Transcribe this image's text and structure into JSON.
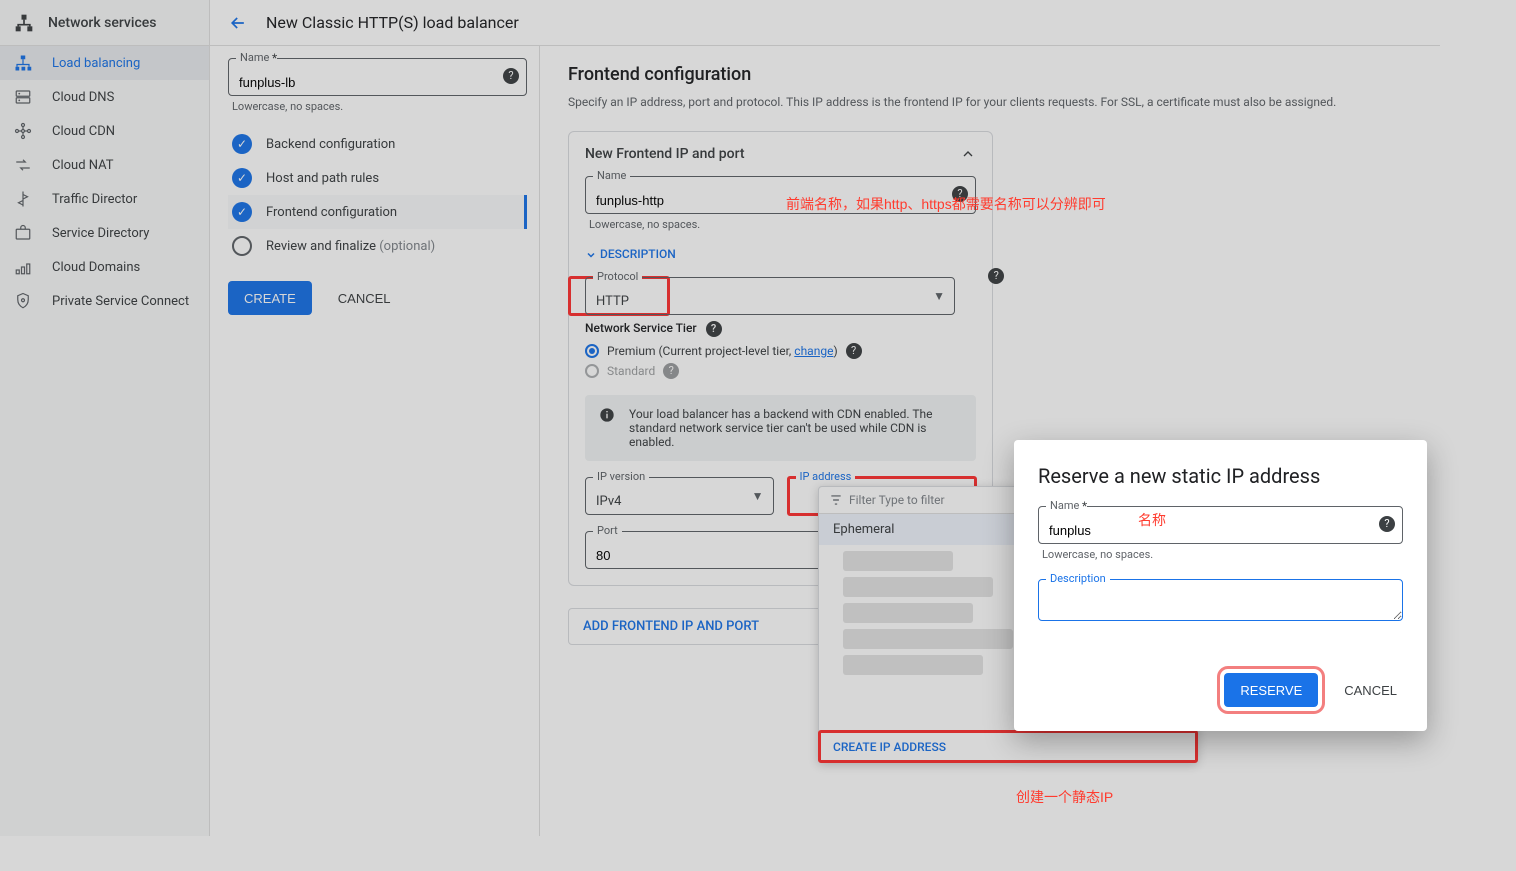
{
  "sidebar": {
    "product_title": "Network services",
    "items": [
      {
        "label": "Load balancing",
        "active": true
      },
      {
        "label": "Cloud DNS"
      },
      {
        "label": "Cloud CDN"
      },
      {
        "label": "Cloud NAT"
      },
      {
        "label": "Traffic Director"
      },
      {
        "label": "Service Directory"
      },
      {
        "label": "Cloud Domains"
      },
      {
        "label": "Private Service Connect"
      }
    ]
  },
  "page": {
    "title": "New Classic HTTP(S) load balancer"
  },
  "name_field": {
    "label": "Name",
    "value": "funplus-lb",
    "hint": "Lowercase, no spaces."
  },
  "steps": {
    "backend": "Backend configuration",
    "host": "Host and path rules",
    "frontend": "Frontend configuration",
    "review": "Review and finalize",
    "optional": "(optional)"
  },
  "buttons": {
    "create": "CREATE",
    "cancel": "CANCEL",
    "reserve": "RESERVE",
    "add_frontend": "ADD FRONTEND IP AND PORT",
    "create_ip": "CREATE IP ADDRESS"
  },
  "panel": {
    "title": "Frontend configuration",
    "desc": "Specify an IP address, port and protocol. This IP address is the frontend IP for your clients requests. For SSL, a certificate must also be assigned."
  },
  "card": {
    "title": "New Frontend IP and port",
    "name_label": "Name",
    "name_value": "funplus-http",
    "name_hint": "Lowercase, no spaces.",
    "description_toggle": "DESCRIPTION",
    "protocol_label": "Protocol",
    "protocol_value": "HTTP",
    "tier_title": "Network Service Tier",
    "tier_premium": "Premium (Current project-level tier, ",
    "tier_change": "change",
    "tier_premium_close": ")",
    "tier_standard": "Standard",
    "banner": "Your load balancer has a backend with CDN enabled. The standard network service tier can't be used while CDN is enabled.",
    "ipv_label": "IP version",
    "ipv_value": "IPv4",
    "ipa_label": "IP address",
    "port_label": "Port",
    "port_value": "80"
  },
  "ip_dropdown": {
    "filter_placeholder": "Filter Type to filter",
    "ephemeral": "Ephemeral"
  },
  "modal": {
    "title": "Reserve a new static IP address",
    "name_label": "Name",
    "name_value": "funplus",
    "name_hint": "Lowercase, no spaces.",
    "desc_label": "Description"
  },
  "annotations": {
    "frontend_name": "前端名称，如果http、https都需要名称可以分辨即可",
    "ip_name": "名称",
    "create_ip": "创建一个静态IP"
  }
}
